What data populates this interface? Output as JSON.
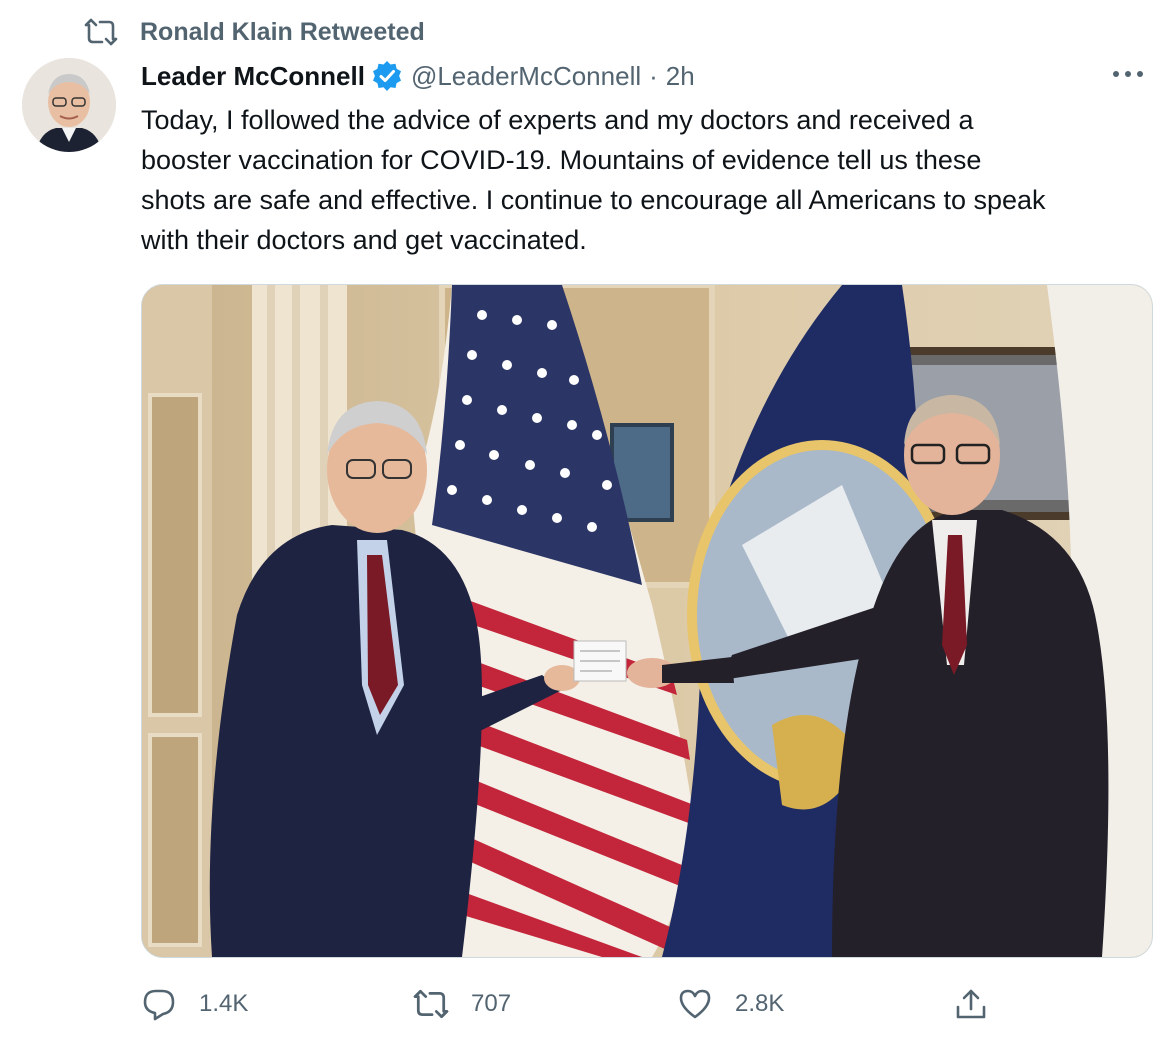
{
  "retweet": {
    "icon": "retweet-icon",
    "label": "Ronald Klain Retweeted"
  },
  "tweet": {
    "display_name": "Leader McConnell",
    "verified_icon": "verified-badge-icon",
    "handle": "@LeaderMcConnell",
    "separator": "·",
    "time": "2h",
    "more_icon": "more-options-icon",
    "text": "Today, I followed the advice of experts and my doctors and received a\nbooster vaccination for COVID-19. Mountains of evidence tell us these\nshots are safe and effective. I continue to encourage all Americans to speak\nwith their doctors and get vaccinated.",
    "media": {
      "description_icon": "photo"
    }
  },
  "actions": {
    "reply": {
      "icon": "reply-icon",
      "count": "1.4K"
    },
    "retweet": {
      "icon": "retweet-icon",
      "count": "707"
    },
    "like": {
      "icon": "heart-icon",
      "count": "2.8K"
    },
    "share": {
      "icon": "share-icon"
    }
  },
  "colors": {
    "text": "#0f1419",
    "muted": "#536471",
    "verified": "#1d9bf0",
    "border": "#cfd9de"
  }
}
